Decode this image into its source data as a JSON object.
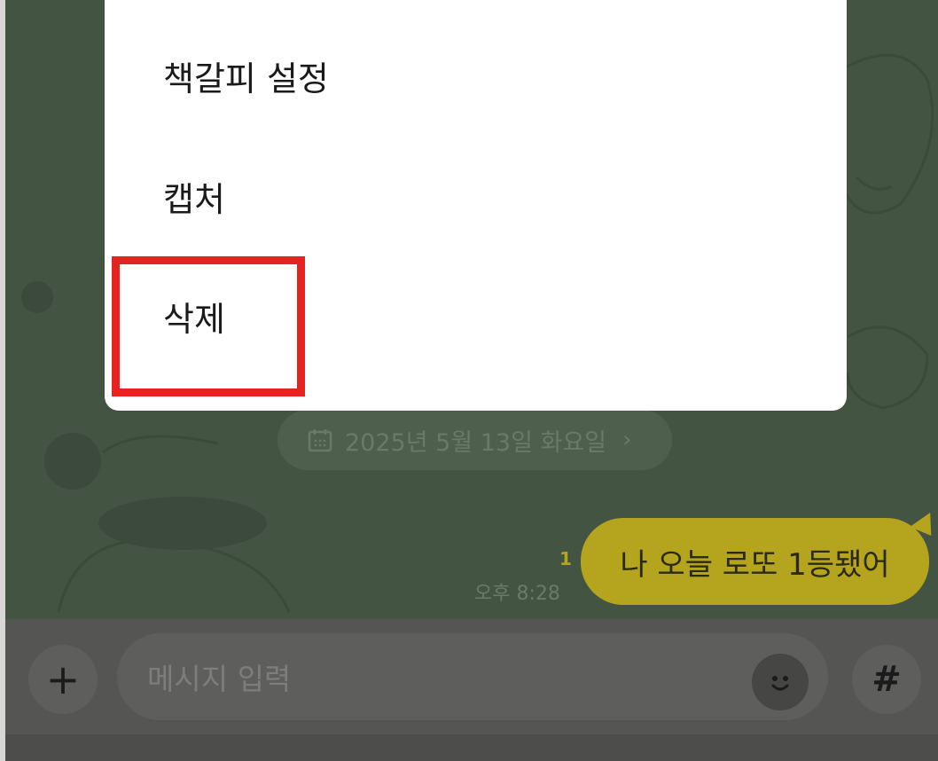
{
  "context_menu": {
    "items": [
      {
        "label": "책갈피 설정"
      },
      {
        "label": "캡처"
      },
      {
        "label": "삭제"
      }
    ]
  },
  "chat": {
    "date_chip": "2025년 5월 13일 화요일",
    "messages": [
      {
        "text": "나 오늘 로또 1등됐어",
        "unread_count": "1",
        "time": "오후 8:28"
      }
    ]
  },
  "input_bar": {
    "placeholder": "메시지 입력",
    "plus_label": "+",
    "hash_label": "#"
  },
  "colors": {
    "chat_background": "#435542",
    "bubble": "#b5a41e",
    "highlight": "#e52421"
  }
}
